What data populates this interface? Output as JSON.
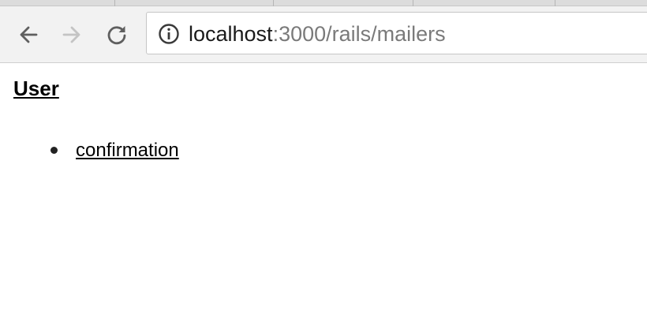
{
  "browser": {
    "url_host": "localhost",
    "url_path": ":3000/rails/mailers"
  },
  "page": {
    "heading": "User",
    "items": [
      {
        "label": "confirmation"
      }
    ]
  }
}
